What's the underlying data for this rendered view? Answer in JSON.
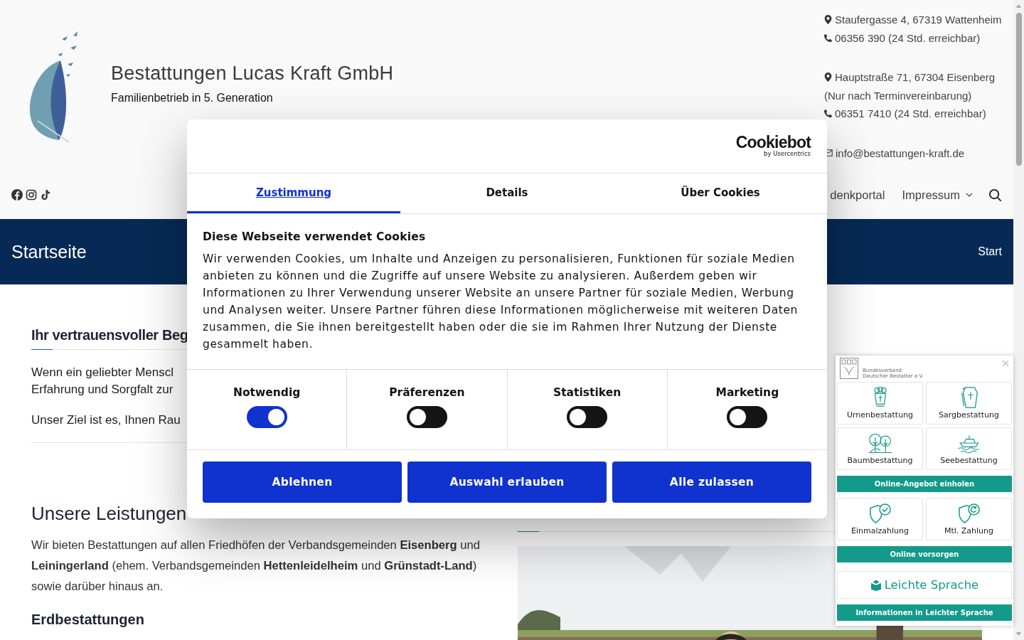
{
  "header": {
    "title": "Bestattungen Lucas Kraft GmbH",
    "tagline": "Familienbetrieb in 5. Generation",
    "contact_groups": [
      [
        {
          "kind": "address",
          "text": "Staufergasse 4, 67319 Wattenheim"
        },
        {
          "kind": "phone",
          "text": "06356 390 (24 Std. erreichbar)"
        }
      ],
      [
        {
          "kind": "address",
          "text": "Hauptstraße 71, 67304 Eisenberg"
        },
        {
          "kind": "note",
          "text": "(Nur nach Terminvereinbarung)"
        },
        {
          "kind": "phone",
          "text": "06351 7410 (24 Std. erreichbar)"
        }
      ],
      [
        {
          "kind": "mail",
          "text": "info@bestattungen-kraft.de"
        }
      ]
    ]
  },
  "nav": {
    "items": [
      {
        "label": "denkportal",
        "dropdown": false
      },
      {
        "label": "Impressum",
        "dropdown": true
      }
    ]
  },
  "banner": {
    "title": "Startseite",
    "breadcrumb": "Start"
  },
  "content": {
    "intro": {
      "heading": "Ihr vertrauensvoller Beg",
      "paragraphs": [
        [
          "Wenn ein geliebter Menscl",
          "Erfahrung und Sorgfalt zur"
        ],
        [
          "Unser Ziel ist es, Ihnen Rau"
        ]
      ]
    },
    "services": {
      "heading": "Unsere Leistungen",
      "text": "Wir bieten Bestattungen auf allen Friedhöfen der Verbandsgemeinden **Eisenberg** und **Leiningerland** (ehem. Verbandsgemeinden **Hettenleidelheim** und **Grünstadt-Land**) sowie darüber hinaus an.",
      "subheading": "Erdbestattungen"
    }
  },
  "consent": {
    "brand": "Cookiebot",
    "brand_sub": "by Usercentrics",
    "tabs": [
      {
        "label": "Zustimmung",
        "selected": true
      },
      {
        "label": "Details",
        "selected": false
      },
      {
        "label": "Über Cookies",
        "selected": false
      }
    ],
    "title": "Diese Webseite verwendet Cookies",
    "text": "Wir verwenden Cookies, um Inhalte und Anzeigen zu personalisieren, Funktionen für soziale Medien anbieten zu können und die Zugriffe auf unsere Website zu analysieren. Außerdem geben wir Informationen zu Ihrer Verwendung unserer Website an unsere Partner für soziale Medien, Werbung und Analysen weiter. Unsere Partner führen diese Informationen möglicherweise mit weiteren Daten zusammen, die Sie ihnen bereitgestellt haben oder die sie im Rahmen Ihrer Nutzung der Dienste gesammelt haben.",
    "categories": [
      {
        "label": "Notwendig",
        "on": true
      },
      {
        "label": "Präferenzen",
        "on": false
      },
      {
        "label": "Statistiken",
        "on": false
      },
      {
        "label": "Marketing",
        "on": false
      }
    ],
    "buttons": [
      "Ablehnen",
      "Auswahl erlauben",
      "Alle zulassen"
    ]
  },
  "widget": {
    "org": [
      "Bundesverband",
      "Deutscher Bestatter e.V."
    ],
    "sections": [
      {
        "kind": "tiles",
        "items": [
          {
            "kind": "urn",
            "label": "Urnenbestattung"
          },
          {
            "kind": "coffin",
            "label": "Sargbestattung"
          },
          {
            "kind": "trees",
            "label": "Baumbestattung"
          },
          {
            "kind": "ship",
            "label": "Seebestattung"
          }
        ]
      },
      {
        "kind": "button",
        "label": "Online-Angebot einholen"
      },
      {
        "kind": "tiles",
        "items": [
          {
            "kind": "shield-check",
            "label": "Einmalzahlung"
          },
          {
            "kind": "shield-repeat",
            "label": "Mtl. Zahlung"
          }
        ]
      },
      {
        "kind": "button",
        "label": "Online vorsorgen"
      },
      {
        "kind": "easy",
        "label": "Leichte Sprache"
      },
      {
        "kind": "button",
        "label": "Informationen in Leichter Sprache"
      }
    ]
  }
}
